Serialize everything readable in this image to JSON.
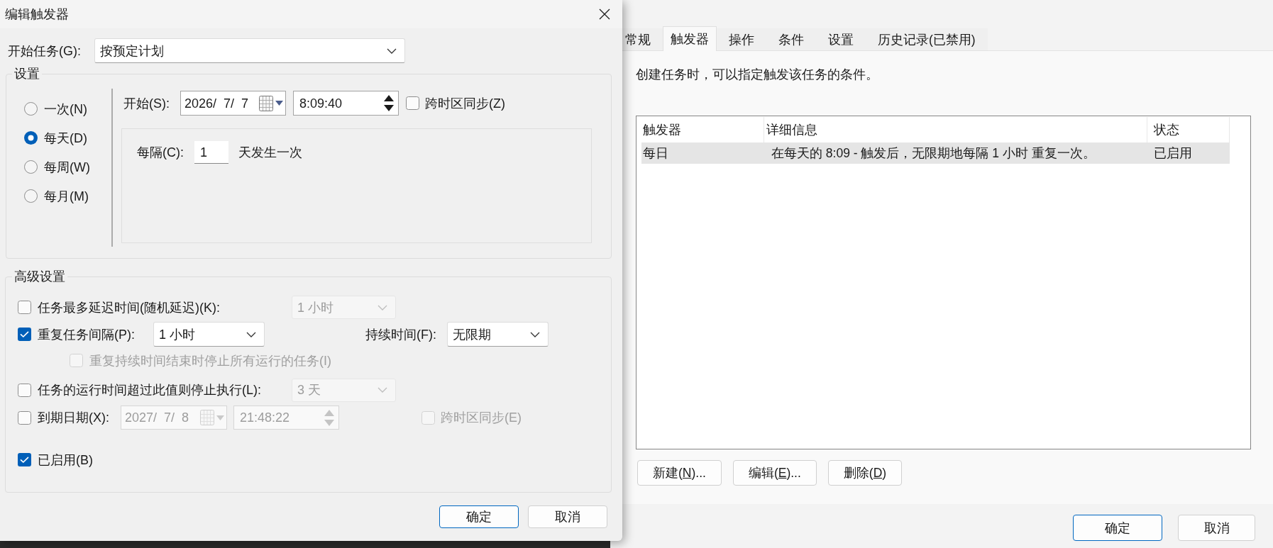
{
  "edit_trigger_dialog": {
    "title": "编辑触发器",
    "begin_task": {
      "label": "开始任务(G):",
      "value": "按预定计划"
    },
    "settings": {
      "group_label": "设置",
      "schedule_options": [
        {
          "label": "一次(N)",
          "selected": false
        },
        {
          "label": "每天(D)",
          "selected": true
        },
        {
          "label": "每周(W)",
          "selected": false
        },
        {
          "label": "每月(M)",
          "selected": false
        }
      ],
      "start": {
        "label": "开始(S):",
        "date": "2026/  7/  7",
        "time": "8:09:40",
        "sync_time_zones": {
          "label": "跨时区同步(Z)",
          "checked": false
        }
      },
      "recur_every": {
        "label": "每隔(C):",
        "value": "1",
        "unit": "天发生一次"
      }
    },
    "advanced": {
      "group_label": "高级设置",
      "delay_task": {
        "label": "任务最多延迟时间(随机延迟)(K):",
        "checked": false,
        "dropdown": {
          "value": "1 小时",
          "disabled": true
        }
      },
      "repeat_task": {
        "label": "重复任务间隔(P):",
        "checked": true,
        "dropdown": {
          "value": "1 小时",
          "disabled": false
        },
        "duration": {
          "label": "持续时间(F):",
          "dropdown": {
            "value": "无限期",
            "disabled": false
          }
        }
      },
      "stop_at_duration_end": {
        "label": "重复持续时间结束时停止所有运行的任务(I)",
        "checked": false,
        "disabled": true
      },
      "stop_if_runs_longer": {
        "label": "任务的运行时间超过此值则停止执行(L):",
        "checked": false,
        "dropdown": {
          "value": "3 天",
          "disabled": true
        }
      },
      "expire": {
        "label": "到期日期(X):",
        "checked": false,
        "date_field": {
          "value": "2027/  7/  8",
          "disabled": true
        },
        "time_field": {
          "value": "21:48:22",
          "disabled": true
        },
        "sync_time_zones": {
          "label": "跨时区同步(E)",
          "checked": false,
          "disabled": true
        }
      },
      "enabled": {
        "label": "已启用(B)",
        "checked": true
      }
    },
    "buttons": [
      {
        "label": "确定",
        "default": true
      },
      {
        "label": "取消",
        "default": false
      }
    ]
  },
  "task_properties_window": {
    "tabs": [
      {
        "label": "常规",
        "selected": false
      },
      {
        "label": "触发器",
        "selected": true
      },
      {
        "label": "操作",
        "selected": false
      },
      {
        "label": "条件",
        "selected": false
      },
      {
        "label": "设置",
        "selected": false
      },
      {
        "label": "历史记录(已禁用)",
        "selected": false
      }
    ],
    "description": "创建任务时，可以指定触发该任务的条件。",
    "triggers_table": {
      "columns": [
        "触发器",
        "详细信息",
        "状态"
      ],
      "rows": [
        {
          "cells": [
            "每日",
            "在每天的 8:09 - 触发后，无限期地每隔 1 小时 重复一次。",
            "已启用"
          ],
          "selected": true
        }
      ]
    },
    "actions": [
      {
        "text_before": "新建(",
        "access_key": "N",
        "text_after": ")..."
      },
      {
        "text_before": "编辑(",
        "access_key": "E",
        "text_after": ")..."
      },
      {
        "text_before": "删除(",
        "access_key": "D",
        "text_after": ")"
      }
    ],
    "buttons": [
      {
        "label": "确定",
        "default": true
      },
      {
        "label": "取消",
        "default": false
      }
    ]
  }
}
